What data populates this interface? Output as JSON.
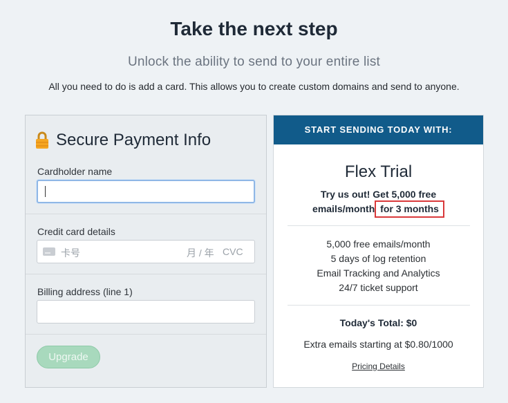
{
  "header": {
    "title": "Take the next step",
    "subtitle": "Unlock the ability to send to your entire list",
    "description": "All you need to do is add a card. This allows you to create custom domains and send to anyone."
  },
  "payment": {
    "title": "Secure Payment Info",
    "icon": "lock-icon",
    "cardholder_label": "Cardholder name",
    "cardholder_value": "",
    "card_label": "Credit card details",
    "card_number_placeholder": "卡号",
    "expiry_placeholder": "月 / 年",
    "cvc_placeholder": "CVC",
    "billing_label": "Billing address (line 1)",
    "billing_value": "",
    "upgrade_label": "Upgrade"
  },
  "plan": {
    "header": "START SENDING TODAY WITH:",
    "name": "Flex Trial",
    "pitch_line1": "Try us out! Get 5,000 free",
    "pitch_line2_a": "emails/month",
    "pitch_line2_b": "for 3 months",
    "features": [
      "5,000 free emails/month",
      "5 days of log retention",
      "Email Tracking and Analytics",
      "24/7 ticket support"
    ],
    "total": "Today's Total: $0",
    "extra": "Extra emails starting at $0.80/1000",
    "pricing_link": "Pricing Details"
  },
  "colors": {
    "plan_header_bg": "#115b8a",
    "upgrade_button_bg": "#a8d9bd",
    "highlight_border": "#d9383a"
  }
}
